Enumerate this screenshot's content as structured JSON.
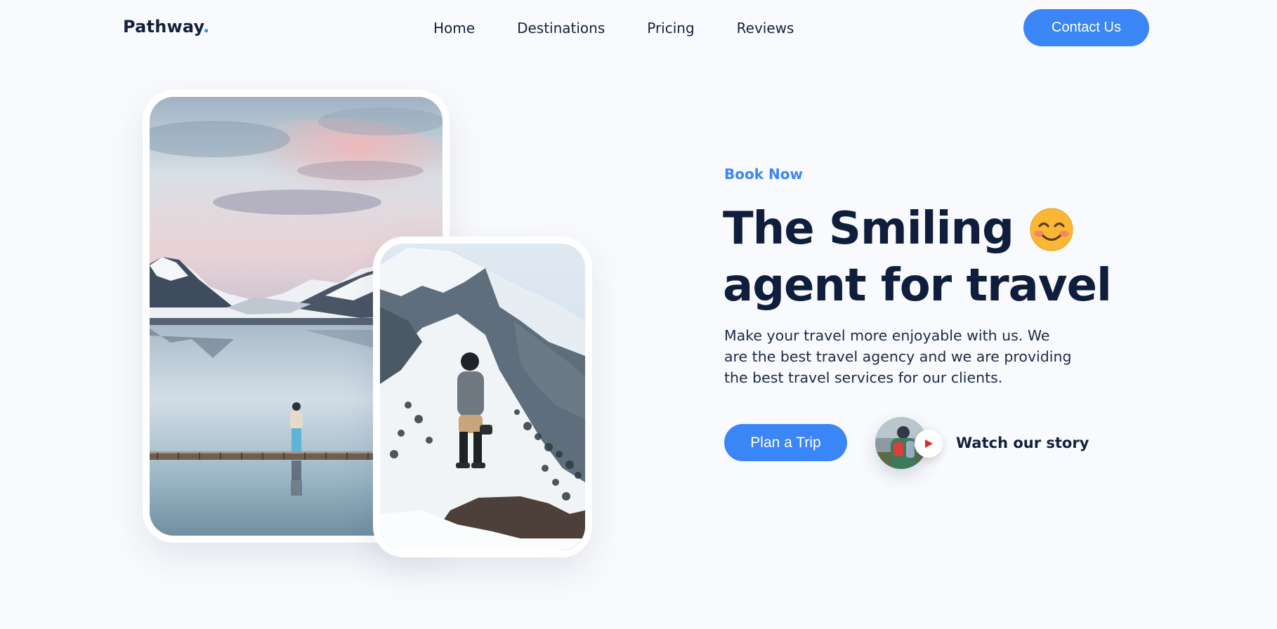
{
  "brand": {
    "name": "Pathway",
    "dot": ".",
    "accent": "#3b86f6",
    "dark": "#0f1e3d"
  },
  "nav": {
    "items": [
      {
        "label": "Home"
      },
      {
        "label": "Destinations"
      },
      {
        "label": "Pricing"
      },
      {
        "label": "Reviews"
      }
    ],
    "contact_label": "Contact Us"
  },
  "hero": {
    "eyebrow": "Book Now",
    "headline_line1": "The Smiling",
    "headline_line2": "agent for travel",
    "headline_icon": "smiling-face-emoji",
    "description": "Make your travel more enjoyable with us. We are the best travel agency and we are providing the best travel services for our clients.",
    "cta_label": "Plan a Trip",
    "story_label": "Watch our story",
    "play_icon": "play-icon"
  },
  "images": {
    "main": "mountain-lake-person-on-pier-photo",
    "secondary": "hiker-on-snowy-mountain-photo",
    "story_thumb": "backpacker-avatar-photo"
  }
}
